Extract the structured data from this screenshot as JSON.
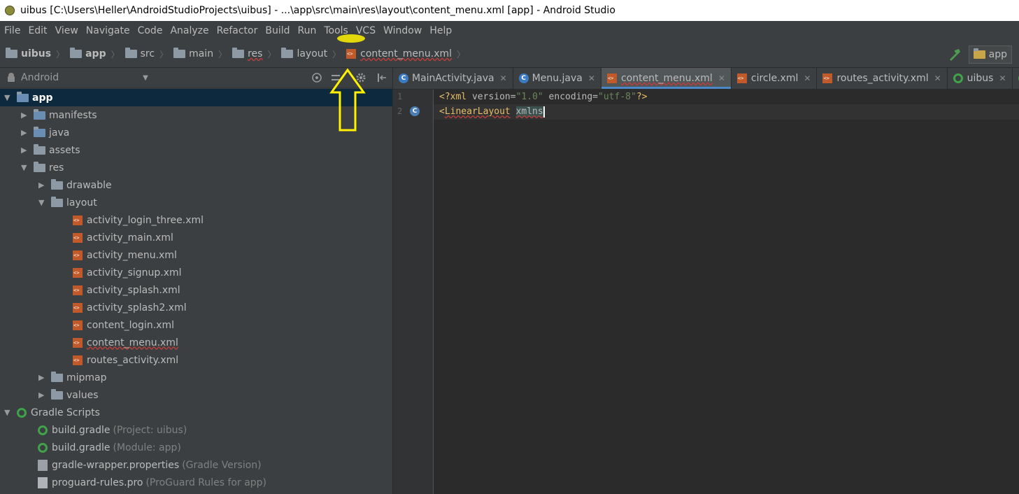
{
  "window": {
    "title": "uibus [C:\\Users\\Heller\\AndroidStudioProjects\\uibus] - ...\\app\\src\\main\\res\\layout\\content_menu.xml [app] - Android Studio"
  },
  "menu": [
    "File",
    "Edit",
    "View",
    "Navigate",
    "Code",
    "Analyze",
    "Refactor",
    "Build",
    "Run",
    "Tools",
    "VCS",
    "Window",
    "Help"
  ],
  "breadcrumb": [
    "uibus",
    "app",
    "src",
    "main",
    "res",
    "layout",
    "content_menu.xml"
  ],
  "run_config": "app",
  "project_view": {
    "mode": "Android"
  },
  "tree": {
    "app": "app",
    "manifests": "manifests",
    "java": "java",
    "assets": "assets",
    "res": "res",
    "drawable": "drawable",
    "layout": "layout",
    "layout_files": [
      "activity_login_three.xml",
      "activity_main.xml",
      "activity_menu.xml",
      "activity_signup.xml",
      "activity_splash.xml",
      "activity_splash2.xml",
      "content_login.xml",
      "content_menu.xml",
      "routes_activity.xml"
    ],
    "mipmap": "mipmap",
    "values": "values",
    "gradle_scripts": "Gradle Scripts",
    "gradle_items": [
      {
        "name": "build.gradle",
        "hint": "(Project: uibus)"
      },
      {
        "name": "build.gradle",
        "hint": "(Module: app)"
      },
      {
        "name": "gradle-wrapper.properties",
        "hint": "(Gradle Version)"
      },
      {
        "name": "proguard-rules.pro",
        "hint": "(ProGuard Rules for app)"
      }
    ]
  },
  "tabs": [
    "MainActivity.java",
    "Menu.java",
    "content_menu.xml",
    "circle.xml",
    "routes_activity.xml",
    "uibus"
  ],
  "active_tab": "content_menu.xml",
  "editor": {
    "line_numbers": [
      "1",
      "2"
    ],
    "line1": {
      "p1": "<?xml ",
      "p2": "version=",
      "p3": "\"1.0\"",
      "p4": " encoding=",
      "p5": "\"utf-8\"",
      "p6": "?>"
    },
    "line2": {
      "lt": "<",
      "tag": "LinearLayout",
      "sp": " ",
      "attr": "xmlns"
    }
  },
  "annotation": {
    "color": "#fff200",
    "target": "Tools"
  }
}
